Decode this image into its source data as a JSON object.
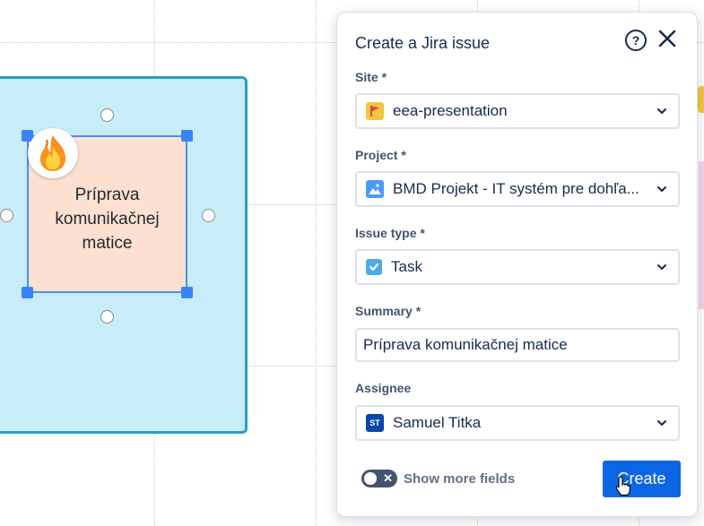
{
  "canvas": {
    "sticky_note": {
      "text": "Príprava komunikačnej matice"
    },
    "reaction_icon": "fire-emoji"
  },
  "dialog": {
    "title": "Create a Jira issue",
    "help_icon": "question-circle-icon",
    "close_icon": "close-icon",
    "fields": {
      "site": {
        "label": "Site *",
        "value": "eea-presentation",
        "icon": "red-flag-icon",
        "icon_bg": "#f5c542"
      },
      "project": {
        "label": "Project *",
        "value": "BMD Projekt - IT systém pre dohľa...",
        "icon": "mountain-image-icon",
        "icon_bg": "#4c9aff"
      },
      "issue_type": {
        "label": "Issue type *",
        "value": "Task",
        "icon": "checkbox-check-icon",
        "icon_bg": "#4bade8"
      },
      "summary": {
        "label": "Summary *",
        "value": "Príprava komunikačnej matice"
      },
      "assignee": {
        "label": "Assignee",
        "value": "Samuel Titka",
        "avatar_initials": "ST",
        "icon_bg": "#0747a6"
      }
    },
    "toggle": {
      "label": "Show more fields",
      "state": "off"
    },
    "create_button": {
      "label": "Create"
    },
    "accent_color": "#0c66e4"
  }
}
